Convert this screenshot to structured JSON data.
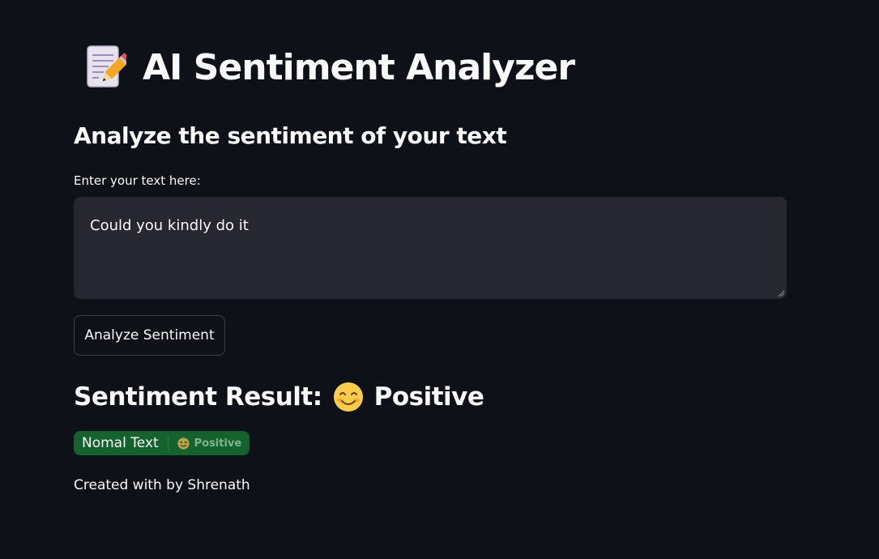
{
  "header": {
    "title": "AI Sentiment Analyzer",
    "title_icon": "memo-icon"
  },
  "subheader": "Analyze the sentiment of your text",
  "input": {
    "label": "Enter your text here:",
    "value": "Could you kindly do it"
  },
  "analyze_button": {
    "label": "Analyze Sentiment"
  },
  "result": {
    "prefix": "Sentiment Result:",
    "emoji_icon": "smiling-face-icon",
    "sentiment": "Positive"
  },
  "badge": {
    "label": "Nomal Text",
    "value": "Positive",
    "icon": "smiling-face-icon",
    "color": "#15622f"
  },
  "footer": "Created with by Shrenath",
  "colors": {
    "background": "#0e1117",
    "input_background": "#262730",
    "text": "#fafafa"
  }
}
